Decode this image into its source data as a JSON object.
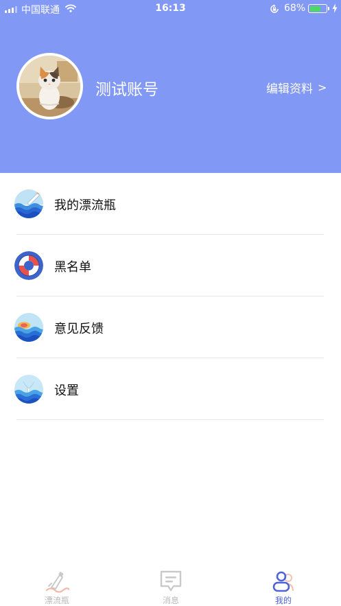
{
  "status_bar": {
    "carrier": "中国联通",
    "time": "16:13",
    "battery": "68%",
    "battery_level": 0.68
  },
  "profile": {
    "username": "测试账号",
    "edit_label": "编辑资料",
    "edit_chevron": ">"
  },
  "menu": {
    "items": [
      {
        "label": "我的漂流瓶",
        "icon": "bottle-waves-icon"
      },
      {
        "label": "黑名单",
        "icon": "lifebuoy-icon"
      },
      {
        "label": "意见反馈",
        "icon": "sunset-sea-icon"
      },
      {
        "label": "设置",
        "icon": "whale-tail-icon"
      }
    ]
  },
  "tabbar": {
    "tabs": [
      {
        "label": "漂流瓶",
        "icon": "bottle-tab-icon",
        "active": false
      },
      {
        "label": "消息",
        "icon": "message-tab-icon",
        "active": false
      },
      {
        "label": "我的",
        "icon": "user-tab-icon",
        "active": true
      }
    ]
  },
  "colors": {
    "header_bg": "#8198f4",
    "active_tab": "#4f63d8",
    "inactive_tab": "#b9b9b9",
    "battery_fill": "#4cd964"
  }
}
